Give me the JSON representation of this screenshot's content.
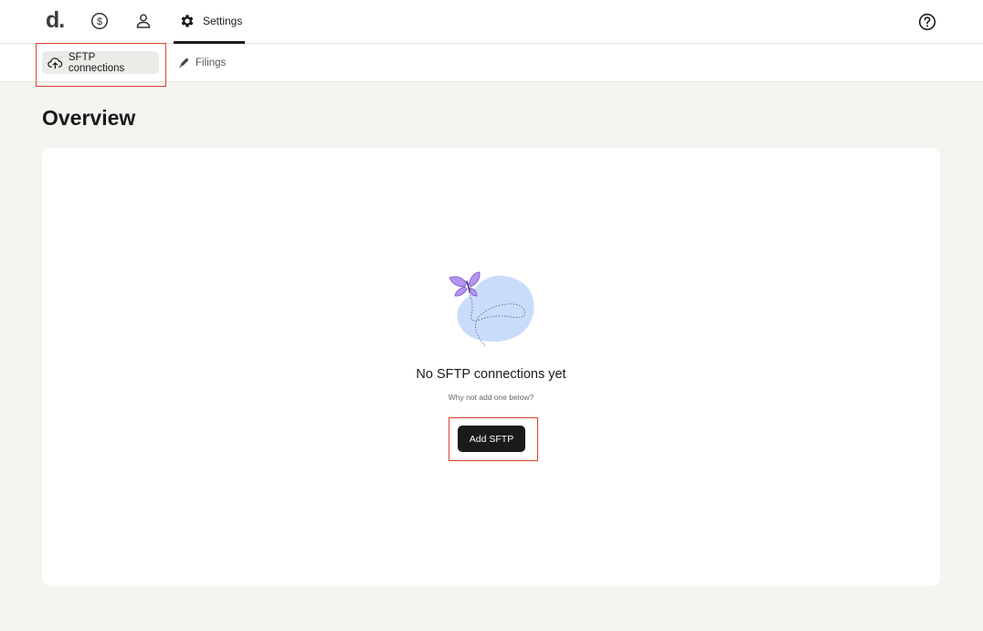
{
  "topbar": {
    "logo": "d.",
    "nav": [
      {
        "icon": "dollar-circle-icon"
      },
      {
        "icon": "user-icon"
      },
      {
        "icon": "gear-icon",
        "label": "Settings",
        "active": true
      }
    ],
    "help_icon": "help-circle-icon"
  },
  "subnav": {
    "tabs": [
      {
        "icon": "cloud-upload-icon",
        "label": "SFTP connections",
        "active": true
      },
      {
        "icon": "pen-icon",
        "label": "Filings",
        "active": false
      }
    ]
  },
  "page": {
    "title": "Overview"
  },
  "empty_state": {
    "illustration": "butterfly-illustration",
    "title": "No SFTP connections yet",
    "subtitle": "Why not add one below?",
    "button_label": "Add SFTP"
  },
  "colors": {
    "highlight": "#d9432c",
    "blob": "#c9dcfa",
    "butterfly": "#9b6fd8",
    "button": "#1a1a1a"
  }
}
